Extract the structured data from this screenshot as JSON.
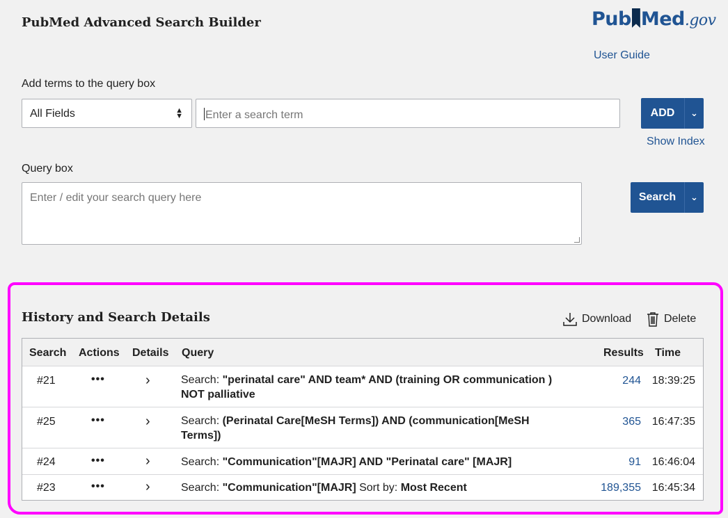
{
  "header": {
    "title": "PubMed Advanced Search Builder",
    "logo_text_left": "Pub",
    "logo_text_right": "Med",
    "logo_suffix": ".gov",
    "user_guide": "User Guide"
  },
  "builder": {
    "add_terms_label": "Add terms to the query box",
    "field_select": "All Fields",
    "term_placeholder": "Enter a search term",
    "add_button": "ADD",
    "show_index": "Show Index",
    "query_box_label": "Query box",
    "query_placeholder": "Enter / edit your search query here",
    "search_button": "Search"
  },
  "history": {
    "title": "History and Search Details",
    "download": "Download",
    "delete": "Delete",
    "columns": [
      "Search",
      "Actions",
      "Details",
      "Query",
      "Results",
      "Time"
    ],
    "rows": [
      {
        "num": "#21",
        "actions": "•••",
        "details": "›",
        "prefix": "Search: ",
        "query_bold": "\"perinatal care\" AND team* AND (training OR communication ) NOT palliative",
        "query_rest": "",
        "sort_bold": "",
        "results": "244",
        "time": "18:39:25"
      },
      {
        "num": "#25",
        "actions": "•••",
        "details": "›",
        "prefix": "Search: ",
        "query_bold": "(Perinatal Care[MeSH Terms]) AND (communication[MeSH Terms])",
        "query_rest": "",
        "sort_bold": "",
        "results": "365",
        "time": "16:47:35"
      },
      {
        "num": "#24",
        "actions": "•••",
        "details": "›",
        "prefix": "Search: ",
        "query_bold": "\"Communication\"[MAJR] AND \"Perinatal care\" [MAJR]",
        "query_rest": "",
        "sort_bold": "",
        "results": "91",
        "time": "16:46:04"
      },
      {
        "num": "#23",
        "actions": "•••",
        "details": "›",
        "prefix": "Search: ",
        "query_bold": "\"Communication\"[MAJR]",
        "query_rest": " Sort by: ",
        "sort_bold": "Most Recent",
        "results": "189,355",
        "time": "16:45:34"
      }
    ]
  },
  "colors": {
    "accent": "#205493",
    "highlight": "#ff00ff",
    "background": "#f1f1f1"
  }
}
